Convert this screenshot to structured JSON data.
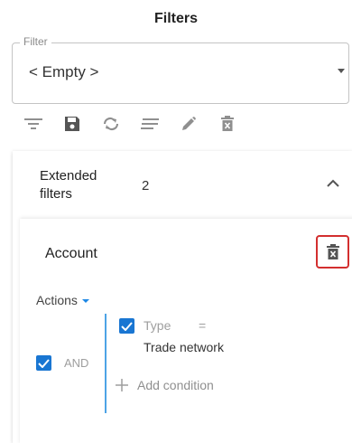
{
  "header": {
    "title": "Filters"
  },
  "filter": {
    "label": "Filter",
    "value": "< Empty >"
  },
  "toolbar": {
    "icons": [
      "filter-list-icon",
      "save-icon",
      "sync-icon",
      "list-icon",
      "edit-pencil-icon",
      "delete-icon"
    ],
    "icon_color": "#8f8f8f",
    "save_color": "#555555"
  },
  "extended": {
    "label": "Extended filters",
    "count": "2"
  },
  "account": {
    "title": "Account",
    "actions_label": "Actions",
    "and_label": "AND",
    "condition": {
      "field": "Type",
      "operator": "=",
      "value": "Trade network"
    },
    "add_condition_label": "Add condition"
  },
  "colors": {
    "accent": "#1976d2",
    "line": "#4da3e6",
    "highlight": "#d32f2f"
  }
}
